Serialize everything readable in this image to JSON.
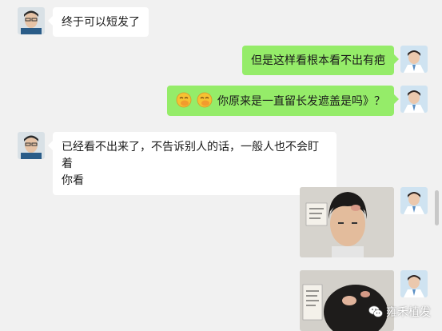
{
  "messages": [
    {
      "side": "left",
      "text": "终于可以短发了"
    },
    {
      "side": "right",
      "text": "但是这样看根本看不出有疤"
    },
    {
      "side": "right",
      "emoji": [
        "face-with-hand-over-mouth-emoji",
        "face-with-hand-over-mouth-emoji"
      ],
      "text": "你原来是一直留长发遮盖是吗》？"
    },
    {
      "side": "left",
      "text_line1": "已经看不出来了，不告诉别人的话，一般人也不会盯着",
      "text_line2": "你看"
    },
    {
      "side": "right",
      "image": "hairline-photo-front"
    },
    {
      "side": "right",
      "image": "hairline-photo-top"
    }
  ],
  "watermark": {
    "text": "雍禾植发",
    "icon": "wechat-icon"
  },
  "colors": {
    "background": "#f1f1f1",
    "bubble_sent": "#95ec69",
    "bubble_received": "#ffffff"
  }
}
